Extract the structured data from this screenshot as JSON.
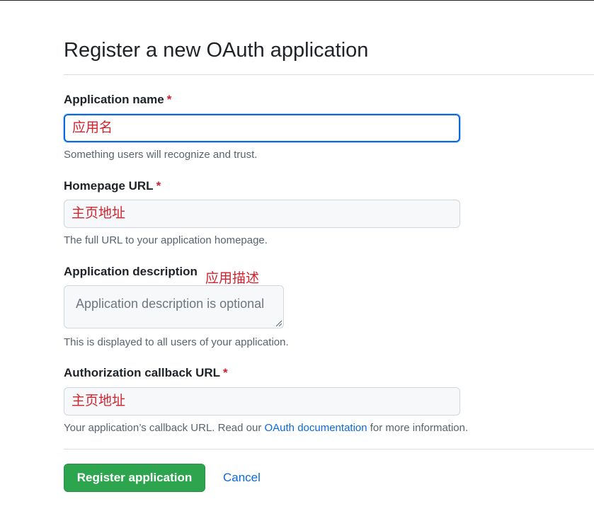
{
  "page_title": "Register a new OAuth application",
  "fields": {
    "app_name": {
      "label": "Application name",
      "required_mark": "*",
      "value": "应用名",
      "hint": "Something users will recognize and trust."
    },
    "homepage_url": {
      "label": "Homepage URL",
      "required_mark": "*",
      "value": "主页地址",
      "hint": "The full URL to your application homepage."
    },
    "description": {
      "label": "Application description",
      "annotation": "应用描述",
      "placeholder": "Application description is optional",
      "hint": "This is displayed to all users of your application."
    },
    "callback_url": {
      "label": "Authorization callback URL",
      "required_mark": "*",
      "value": "主页地址",
      "hint_prefix": "Your application’s callback URL. Read our ",
      "hint_link": "OAuth documentation",
      "hint_suffix": " for more information."
    }
  },
  "actions": {
    "register_label": "Register application",
    "cancel_label": "Cancel"
  },
  "colors": {
    "primary_button": "#2da44e",
    "link": "#0969da",
    "required": "#cf222e",
    "annotation_text": "#d1242f",
    "focus_border": "#0969da"
  }
}
